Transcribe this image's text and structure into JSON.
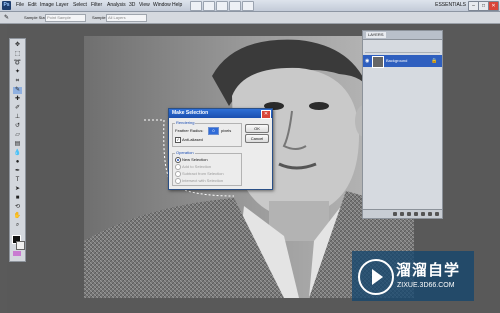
{
  "app": {
    "logo": "Ps"
  },
  "menu": [
    "File",
    "Edit",
    "Image",
    "Layer",
    "Select",
    "Filter",
    "Analysis",
    "3D",
    "View",
    "Window",
    "Help"
  ],
  "workspace": "ESSENTIALS",
  "window_controls": [
    "–",
    "□",
    "✕"
  ],
  "options_bar": {
    "sample_size_label": "Sample Size:",
    "sample_size_value": "Point Sample",
    "sample_label": "Sample:",
    "sample_value": "All Layers"
  },
  "layers_panel": {
    "tab": "LAYERS",
    "layer_name": "Background",
    "visibility_icon": "eye-icon",
    "lock_icon": "lock-icon"
  },
  "dialog": {
    "title": "Make Selection",
    "rendering_group": "Rendering",
    "feather_label": "Feather Radius:",
    "feather_value": "0",
    "feather_unit": "pixels",
    "anti_alias_label": "Anti-aliased",
    "anti_alias_checked": true,
    "operation_group": "Operation",
    "operations": [
      "New Selection",
      "Add to Selection",
      "Subtract from Selection",
      "Intersect with Selection"
    ],
    "selected_operation": "New Selection",
    "ok_label": "OK",
    "cancel_label": "Cancel"
  },
  "watermark": {
    "text": "溜溜自学",
    "url": "ZIXUE.3D66.COM"
  }
}
